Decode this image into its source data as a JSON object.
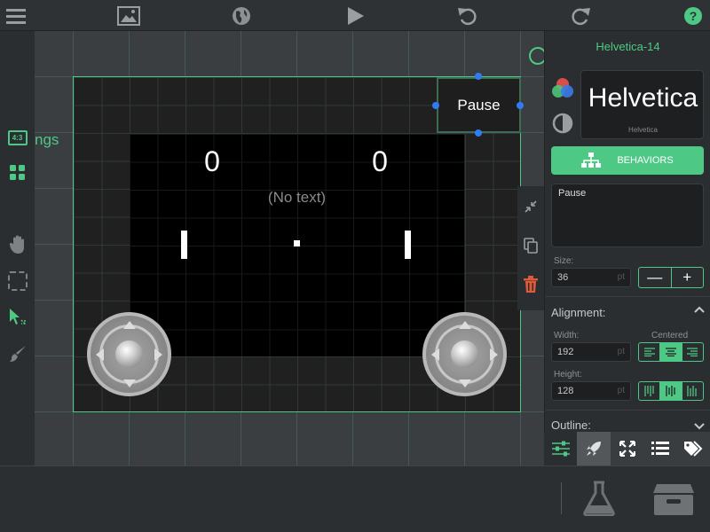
{
  "toolbar": {
    "icons": [
      "menu-icon",
      "image-icon",
      "globe-icon",
      "play-icon",
      "undo-icon",
      "redo-icon",
      "help-icon"
    ],
    "accent": "#4ec985"
  },
  "left_rail": {
    "aspect_badge": "4:3"
  },
  "canvas": {
    "scene_label": "ngs",
    "score_left": "0",
    "score_right": "0",
    "placeholder_text": "(No text)",
    "pause_label": "Pause"
  },
  "inspector": {
    "title": "Helvetica-14",
    "font_preview": "Helvetica",
    "font_preview_sub": "Helvetica",
    "behaviors_label": "BEHAVIORS",
    "text_value": "Pause",
    "size_label": "Size:",
    "size_value": "36",
    "unit": "pt",
    "stepper_minus": "—",
    "stepper_plus": "+",
    "alignment_label": "Alignment:",
    "width_label": "Width:",
    "width_value": "192",
    "centered_label": "Centered",
    "height_label": "Height:",
    "height_value": "128",
    "outline_label": "Outline:"
  },
  "colors": {
    "accent": "#4ec985",
    "selection_handle": "#2f7cf6",
    "delete": "#e05a3a"
  }
}
